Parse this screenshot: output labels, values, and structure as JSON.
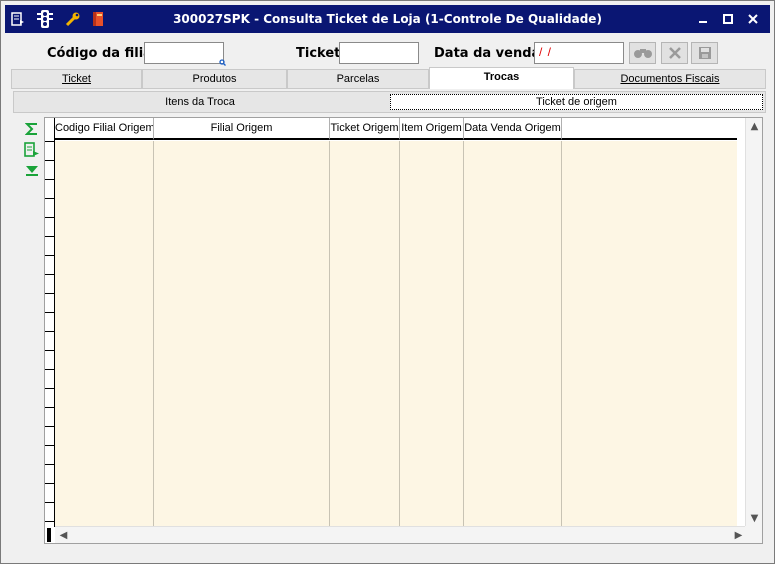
{
  "window": {
    "title": "300027SPK - Consulta Ticket de Loja (1-Controle De Qualidade)",
    "icons": [
      "menu-icon",
      "traffic-light-icon",
      "wrench-icon",
      "book-icon"
    ],
    "controls": [
      "minimize-icon",
      "maximize-icon",
      "close-icon"
    ]
  },
  "search": {
    "filial_label": "Código da filial",
    "filial_value": "",
    "ticket_label": "Ticket",
    "ticket_value": "",
    "data_label": "Data da venda",
    "data_value": "/ /"
  },
  "tabs": [
    {
      "label": "Ticket",
      "active": false
    },
    {
      "label": "Produtos",
      "active": false
    },
    {
      "label": "Parcelas",
      "active": false
    },
    {
      "label": "Trocas",
      "active": true
    },
    {
      "label": "Documentos Fiscais",
      "active": false
    }
  ],
  "subtabs": [
    {
      "label": "Itens da Troca",
      "active": false
    },
    {
      "label": "Ticket de origem",
      "active": true
    }
  ],
  "grid": {
    "columns": [
      "Codigo Filial Origem",
      "Filial Origem",
      "Ticket Origem",
      "Item Origem",
      "Data Venda Origem"
    ],
    "rows": []
  },
  "colors": {
    "titlebar": "#0a1673",
    "grid_body": "#fdf6e4",
    "date_text": "#e00000",
    "icon_green": "#1aa33a"
  }
}
